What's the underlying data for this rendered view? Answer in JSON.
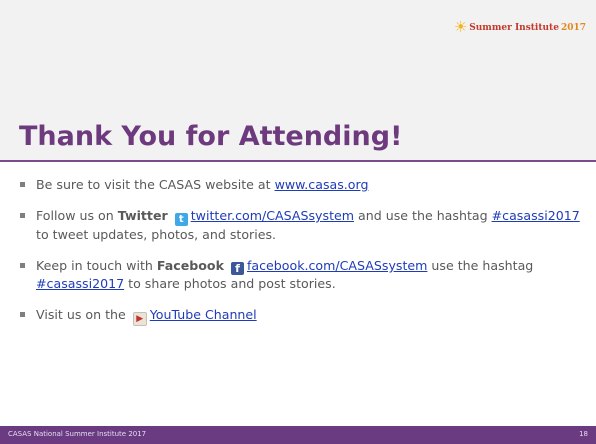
{
  "logo": {
    "text": "Summer Institute",
    "year": "2017"
  },
  "slide": {
    "title": "Thank You for Attending!"
  },
  "bullets": {
    "b1": {
      "text": "Be sure to visit the CASAS website at ",
      "link": "www.casas.org"
    },
    "b2": {
      "pre": "Follow us on ",
      "platform": "Twitter",
      "link": "twitter.com/CASASsystem",
      "mid": " and use the hashtag ",
      "hashtag": "#casassi2017",
      "post": " to tweet updates, photos, and stories."
    },
    "b3": {
      "pre": "Keep in touch with ",
      "platform": "Facebook",
      "link": "facebook.com/CASASsystem",
      "mid": " use the hashtag ",
      "hashtag": "#casassi2017",
      "post": " to share photos and post stories."
    },
    "b4": {
      "pre": "Visit us on the ",
      "link": "YouTube Channel"
    }
  },
  "footer": {
    "left": "CASAS National Summer Institute 2017",
    "page": "18"
  },
  "icons": {
    "twitter": "twitter-icon",
    "facebook": "facebook-icon",
    "youtube": "youtube-icon",
    "logo_sun": "sun-icon"
  },
  "colors": {
    "title": "#6d3a7e",
    "rule": "#7a4b8a",
    "footer": "#6b3b82",
    "link": "#1f3cb8",
    "body_text": "#595959"
  }
}
